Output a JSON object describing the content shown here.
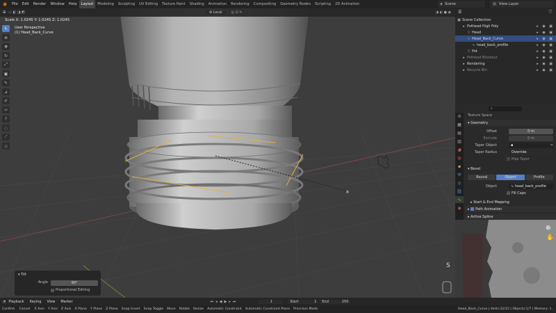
{
  "menu": [
    "File",
    "Edit",
    "Render",
    "Window",
    "Help"
  ],
  "workspaces": [
    "Layout",
    "Modeling",
    "Sculpting",
    "UV Editing",
    "Texture Paint",
    "Shading",
    "Animation",
    "Rendering",
    "Compositing",
    "Geometry Nodes",
    "Scripting",
    "2D Animation"
  ],
  "active_workspace": "Layout",
  "scene": "Scene",
  "view_layer": "View Layer",
  "viewport": {
    "orientation": "Local",
    "scale_readout": "Scale X: 1.0245   Y: 1.0245   Z: 1.0245",
    "view_name": "User Perspective",
    "object_name": "(1) Head_Back_Curve"
  },
  "tilt_panel": {
    "title": "Tilt",
    "angle_label": "Angle",
    "angle_value": "90°",
    "prop_edit": "Proportional Editing"
  },
  "outliner": [
    {
      "label": "Scene Collection",
      "indent": 0,
      "icon": "▣",
      "selected": false
    },
    {
      "label": "Pothead High Poly",
      "indent": 1,
      "icon": "▸",
      "selected": false
    },
    {
      "label": "Head",
      "indent": 2,
      "icon": "▽",
      "selected": false
    },
    {
      "label": "Head_Back_Curve",
      "indent": 2,
      "icon": "∿",
      "selected": true
    },
    {
      "label": "head_back_profile",
      "indent": 3,
      "icon": "∿",
      "selected": false
    },
    {
      "label": "Pot",
      "indent": 2,
      "icon": "▽",
      "selected": false
    },
    {
      "label": "Pothead Blockout",
      "indent": 1,
      "icon": "▸",
      "selected": false
    },
    {
      "label": "Rendering",
      "indent": 1,
      "icon": "▸",
      "selected": false
    },
    {
      "label": "Recycle Bin",
      "indent": 1,
      "icon": "▸",
      "selected": false
    }
  ],
  "properties": {
    "breadcrumb": "Texture Space",
    "geometry_header": "Geometry",
    "offset_label": "Offset",
    "offset_value": "0 m",
    "extrude_label": "Extrude",
    "extrude_value": "0 m",
    "taper_object_label": "Taper Object",
    "taper_radius_label": "Taper Radius",
    "taper_radius_value": "Override",
    "map_taper": "Map Taper",
    "bevel_header": "Bevel",
    "bevel_modes": [
      "Round",
      "Object",
      "Profile"
    ],
    "bevel_active": "Object",
    "object_label": "Object",
    "object_value": "head_back_profile",
    "fill_caps": "Fill Caps",
    "start_end": "Start & End Mapping",
    "path_animation": "Path Animation",
    "active_spline": "Active Spline"
  },
  "timeline": {
    "items": [
      "Playback",
      "Keying",
      "View",
      "Marker"
    ],
    "current_frame": "1",
    "start_label": "Start",
    "start_value": "1",
    "end_label": "End",
    "end_value": "250"
  },
  "statusbar": {
    "left": [
      "Confirm",
      "Cancel",
      "X Axis",
      "Y Axis",
      "Z Axis",
      "X Plane",
      "Y Plane",
      "Z Plane",
      "Snap Invert",
      "Snap Toggle",
      "Move",
      "Rotate",
      "Resize",
      "Automatic Constraint",
      "Automatic Constraint Plane",
      "Precision Mode"
    ],
    "right": "Head_Back_Curve | Verts:32/12 | Objects:1/7 | Memory: 1..."
  },
  "colors": {
    "accent": "#5680c2",
    "selection": "#334d80",
    "curve": "#e0b040",
    "viewport_bg": "#3d3d3d"
  }
}
